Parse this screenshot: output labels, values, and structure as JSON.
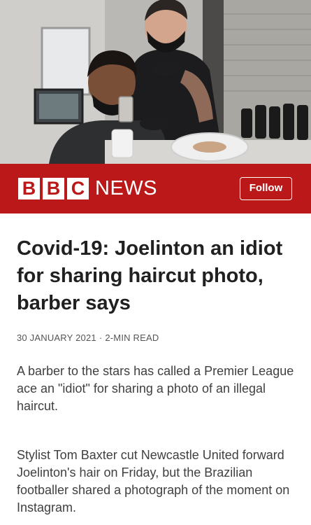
{
  "brand": {
    "bbc_letters": [
      "B",
      "B",
      "C"
    ],
    "news_label": "NEWS",
    "follow_label": "Follow",
    "color": "#bb1919"
  },
  "article": {
    "headline": "Covid-19: Joelinton an idiot for sharing haircut photo, barber says",
    "date": "30 JANUARY 2021",
    "separator": "·",
    "read_time": "2-MIN READ",
    "paragraphs": [
      "A barber to the stars has called a Premier League ace an \"idiot\" for sharing a photo of an illegal haircut.",
      "Stylist Tom Baxter cut Newcastle United forward Joelinton's hair on Friday, but the Brazilian footballer shared a photograph of the moment on Instagram."
    ]
  }
}
